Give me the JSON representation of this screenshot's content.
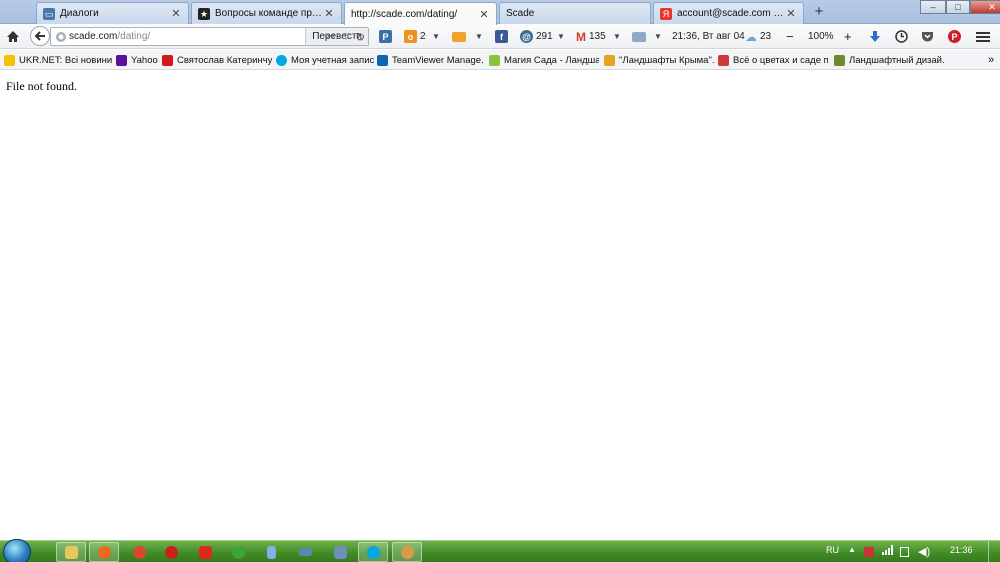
{
  "tabs": [
    {
      "title": "Диалоги",
      "icon": "speech-bubble-icon",
      "color": "#4a76a8"
    },
    {
      "title": "Вопросы команде проект...",
      "icon": "star-icon",
      "color": "#222222"
    },
    {
      "title": "http://scade.com/dating/",
      "icon": "",
      "color": ""
    },
    {
      "title": "Scade",
      "icon": "",
      "color": ""
    },
    {
      "title": "account@scade.com — Ян...",
      "icon": "yandex-mail-icon",
      "color": "#e8362d"
    }
  ],
  "new_tab_symbol": "+",
  "window_controls": {
    "minimize": "–",
    "maximize": "□",
    "close": "✕"
  },
  "toolbar": {
    "url_host": "scade.com",
    "url_path": "/dating/",
    "translate_label": "Перевести",
    "ok_badge": "2",
    "facebook_label": "f",
    "counter_291": "291",
    "gmail_count": "135",
    "datetime": "21:36, Вт авг 04",
    "weather_value": "23",
    "zoom_minus": "−",
    "zoom_level": "100%",
    "zoom_plus": "+"
  },
  "bookmarks": [
    {
      "label": "UKR.NET: Всі новини ...",
      "color": "#f2c200"
    },
    {
      "label": "Yahoo",
      "color": "#5b0f9c"
    },
    {
      "label": "Святослав Катеринчу...",
      "color": "#d11a1a"
    },
    {
      "label": "Моя учетная запись",
      "color": "#00a8e6"
    },
    {
      "label": "TeamViewer Manage...",
      "color": "#0e66b3"
    },
    {
      "label": "Магия Сада - Ландша...",
      "color": "#8ac43f"
    },
    {
      "label": "\"Ландшафты Крыма\"...",
      "color": "#e0a420"
    },
    {
      "label": "Всё о цветах и саде п...",
      "color": "#cc3b3b"
    },
    {
      "label": "Ландшафтный дизай...",
      "color": "#6f8a2e"
    }
  ],
  "bookmarks_overflow": "»",
  "page": {
    "message": "File not found."
  },
  "taskbar": {
    "apps": [
      {
        "name": "explorer",
        "color": "#e6c75a"
      },
      {
        "name": "firefox",
        "color": "#e66b1a"
      },
      {
        "name": "chrome",
        "color": "#d6492d"
      },
      {
        "name": "opera",
        "color": "#c8231a"
      },
      {
        "name": "yandex",
        "color": "#e0271b"
      },
      {
        "name": "utorrent",
        "color": "#3aa53a"
      },
      {
        "name": "notepad",
        "color": "#7fb2e5"
      },
      {
        "name": "keyboard",
        "color": "#5f86b3"
      },
      {
        "name": "network",
        "color": "#6d8fb8"
      },
      {
        "name": "skype",
        "color": "#00a8e6"
      },
      {
        "name": "app",
        "color": "#d89a4a"
      }
    ],
    "language": "RU",
    "clock": "21:36"
  }
}
